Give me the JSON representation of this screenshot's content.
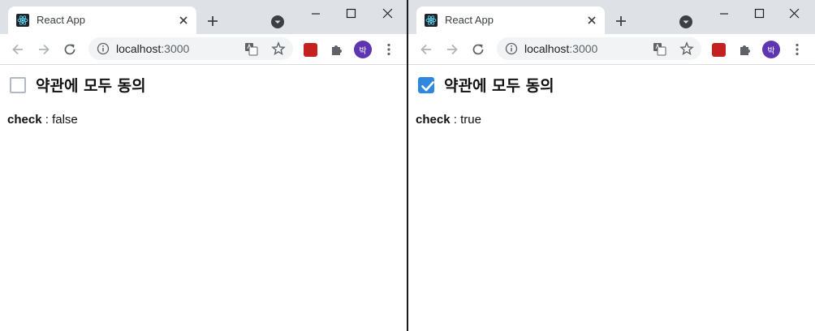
{
  "windows": [
    {
      "tab_title": "React App",
      "url_host": "localhost",
      "url_port": ":3000",
      "avatar_text": "박",
      "checkbox_label": "약관에 모두 동의",
      "checked": false,
      "status_key": "check",
      "status_sep": " : ",
      "status_value": "false"
    },
    {
      "tab_title": "React App",
      "url_host": "localhost",
      "url_port": ":3000",
      "avatar_text": "박",
      "checkbox_label": "약관에 모두 동의",
      "checked": true,
      "status_key": "check",
      "status_sep": " : ",
      "status_value": "true"
    }
  ],
  "colors": {
    "checkbox_checked": "#2f88e0",
    "checkbox_border": "#b3b9c4",
    "avatar": "#5e35b1",
    "tabbar": "#dee1e6"
  }
}
